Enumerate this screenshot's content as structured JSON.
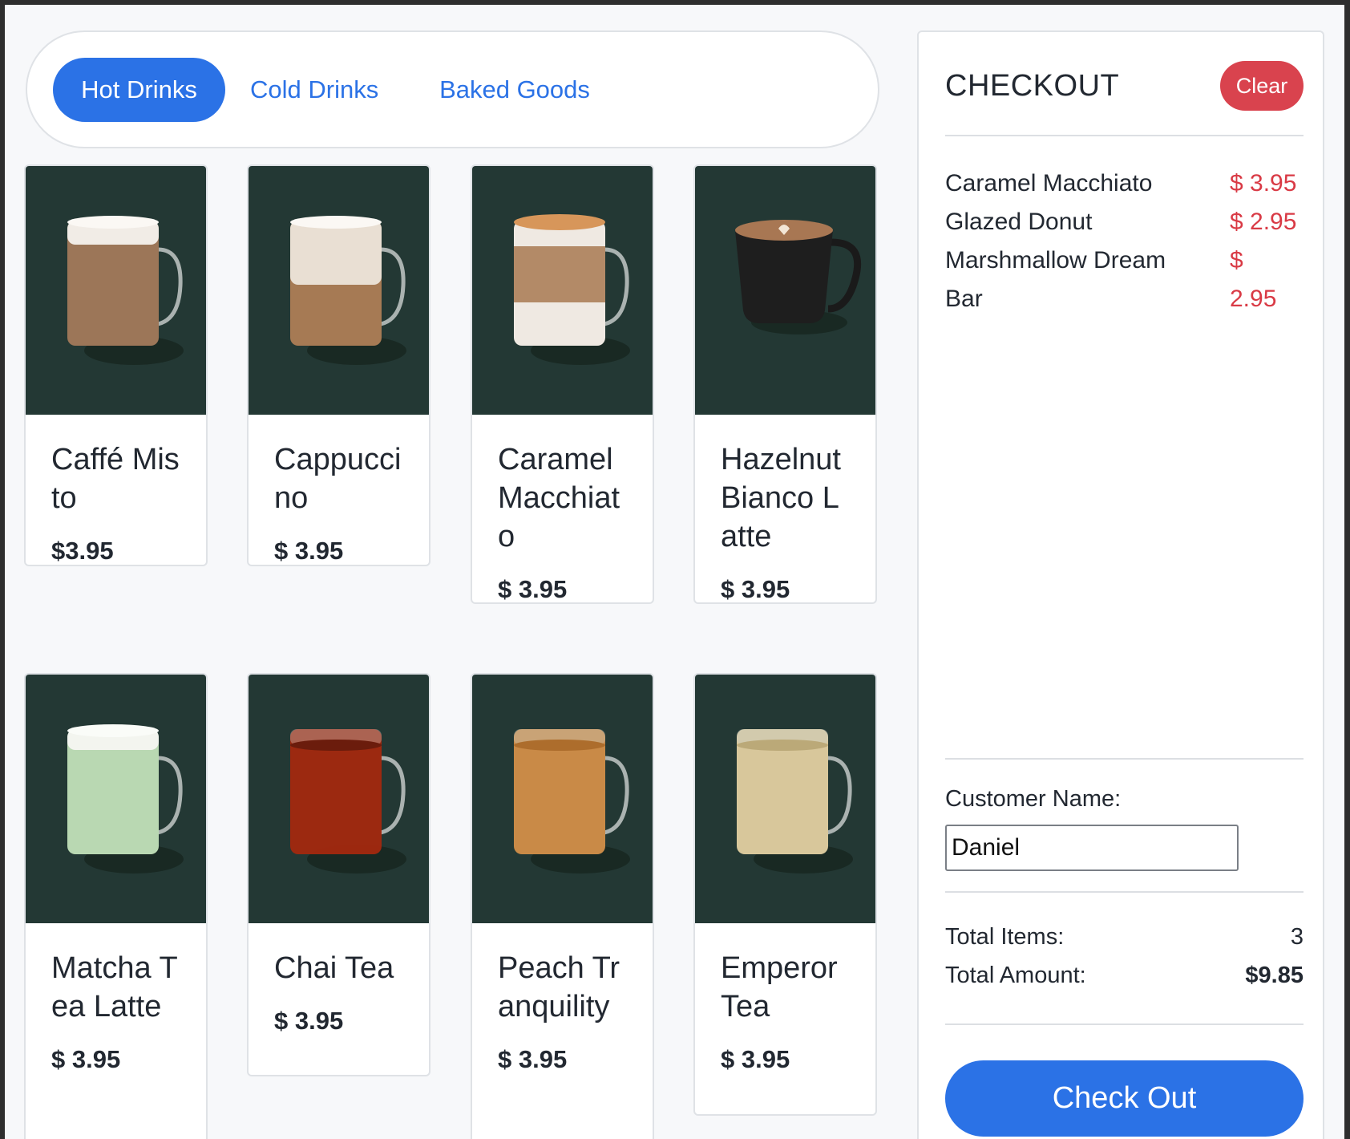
{
  "tabs": [
    {
      "label": "Hot Drinks",
      "active": true
    },
    {
      "label": "Cold Drinks",
      "active": false
    },
    {
      "label": "Baked Goods",
      "active": false
    }
  ],
  "products": [
    {
      "name": "Caffé Misto",
      "price": "$3.95",
      "image": "caffe-misto-mug"
    },
    {
      "name": "Cappuccino",
      "price": "$ 3.95",
      "image": "cappuccino-mug"
    },
    {
      "name": "Caramel Macchiato",
      "price": "$ 3.95",
      "image": "caramel-macchiato-mug"
    },
    {
      "name": "Hazelnut Bianco Latte",
      "price": "$ 3.95",
      "image": "black-latte-mug"
    },
    {
      "name": "Matcha Tea Latte",
      "price": "$ 3.95",
      "image": "matcha-mug"
    },
    {
      "name": "Chai Tea",
      "price": "$ 3.95",
      "image": "chai-tea-mug"
    },
    {
      "name": "Peach Tranquility",
      "price": "$ 3.95",
      "image": "peach-tea-mug"
    },
    {
      "name": "Emperor Tea",
      "price": "$ 3.95",
      "image": "emperor-tea-mug"
    }
  ],
  "checkout": {
    "title": "CHECKOUT",
    "clear_label": "Clear",
    "items": [
      {
        "name": "Caramel Macchiato",
        "price": "$ 3.95"
      },
      {
        "name": "Glazed Donut",
        "price": "$ 2.95"
      },
      {
        "name": "Marshmallow Dream Bar",
        "price": "$ 2.95"
      }
    ],
    "customer_label": "Customer Name:",
    "customer_value": "Daniel",
    "total_items_label": "Total Items:",
    "total_items_value": "3",
    "total_amount_label": "Total Amount:",
    "total_amount_value": "$9.85",
    "checkout_label": "Check Out"
  },
  "colors": {
    "accent": "#2b72e6",
    "danger": "#d9434e",
    "card_image_bg": "#233834",
    "price_red": "#d93a45"
  }
}
